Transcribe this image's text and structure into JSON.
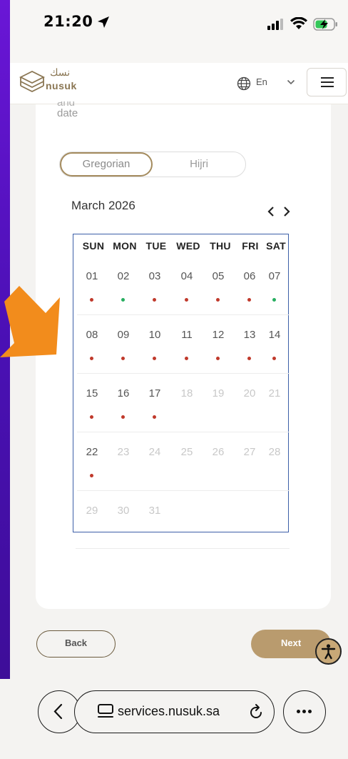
{
  "status_bar": {
    "time": "21:20"
  },
  "header": {
    "logo_text": "nusuk",
    "logo_arabic": "نسك",
    "language": "En"
  },
  "form": {
    "section_label_cut": "and",
    "section_label": "date",
    "calendar_type": {
      "options": [
        "Gregorian",
        "Hijri"
      ],
      "selected": "Gregorian"
    },
    "month_title": "March 2026"
  },
  "calendar": {
    "weekdays": [
      "SUN",
      "MON",
      "TUE",
      "WED",
      "THU",
      "FRI",
      "SAT"
    ],
    "weeks": [
      [
        {
          "d": "01",
          "on": true,
          "dot": "#c0392b"
        },
        {
          "d": "02",
          "on": true,
          "dot": "#27ae60"
        },
        {
          "d": "03",
          "on": true,
          "dot": "#c0392b"
        },
        {
          "d": "04",
          "on": true,
          "dot": "#c0392b"
        },
        {
          "d": "05",
          "on": true,
          "dot": "#c0392b"
        },
        {
          "d": "06",
          "on": true,
          "dot": "#c0392b"
        },
        {
          "d": "07",
          "on": true,
          "dot": "#27ae60"
        }
      ],
      [
        {
          "d": "08",
          "on": true,
          "dot": "#c0392b"
        },
        {
          "d": "09",
          "on": true,
          "dot": "#c0392b"
        },
        {
          "d": "10",
          "on": true,
          "dot": "#c0392b"
        },
        {
          "d": "11",
          "on": true,
          "dot": "#c0392b"
        },
        {
          "d": "12",
          "on": true,
          "dot": "#c0392b"
        },
        {
          "d": "13",
          "on": true,
          "dot": "#c0392b"
        },
        {
          "d": "14",
          "on": true,
          "dot": "#c0392b"
        }
      ],
      [
        {
          "d": "15",
          "on": true,
          "dot": "#c0392b"
        },
        {
          "d": "16",
          "on": true,
          "dot": "#c0392b"
        },
        {
          "d": "17",
          "on": true,
          "dot": "#c0392b"
        },
        {
          "d": "18",
          "on": false,
          "dot": null
        },
        {
          "d": "19",
          "on": false,
          "dot": null
        },
        {
          "d": "20",
          "on": false,
          "dot": null
        },
        {
          "d": "21",
          "on": false,
          "dot": null
        }
      ],
      [
        {
          "d": "22",
          "on": true,
          "dot": "#c0392b"
        },
        {
          "d": "23",
          "on": false,
          "dot": null
        },
        {
          "d": "24",
          "on": false,
          "dot": null
        },
        {
          "d": "25",
          "on": false,
          "dot": null
        },
        {
          "d": "26",
          "on": false,
          "dot": null
        },
        {
          "d": "27",
          "on": false,
          "dot": null
        },
        {
          "d": "28",
          "on": false,
          "dot": null
        }
      ],
      [
        {
          "d": "29",
          "on": false,
          "dot": null
        },
        {
          "d": "30",
          "on": false,
          "dot": null
        },
        {
          "d": "31",
          "on": false,
          "dot": null
        }
      ]
    ]
  },
  "buttons": {
    "back": "Back",
    "next": "Next"
  },
  "browser": {
    "url": "services.nusuk.sa"
  },
  "colors": {
    "accent": "#b99b6e",
    "highlight_border": "#3c5fa8",
    "arrow": "#f28c1c",
    "available_dot": "#27ae60",
    "unavailable_dot": "#c0392b"
  }
}
